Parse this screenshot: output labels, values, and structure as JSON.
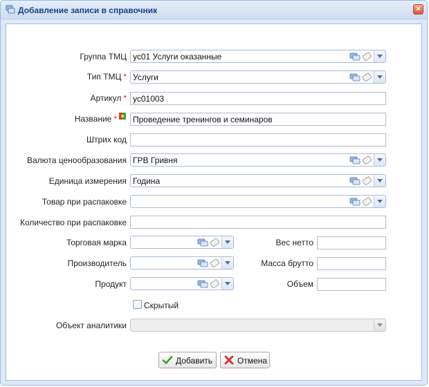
{
  "window": {
    "title": "Добавление записи в справочник",
    "close_glyph": "×"
  },
  "form": {
    "group": {
      "label": "Группа ТМЦ",
      "value": "ус01 Услуги оказанные"
    },
    "type": {
      "label": "Тип ТМЦ",
      "required": "*",
      "value": "Услуги"
    },
    "article": {
      "label": "Артикул",
      "required": "*",
      "value": "ус01003"
    },
    "name": {
      "label": "Название",
      "required": "*",
      "value": "Проведение тренингов и семинаров"
    },
    "barcode": {
      "label": "Штрих код",
      "value": ""
    },
    "currency": {
      "label": "Валюта ценообразования",
      "value": "ГРВ Гривня"
    },
    "unit": {
      "label": "Единица измерения",
      "value": "Година"
    },
    "unpack_item": {
      "label": "Товар при распаковке",
      "value": ""
    },
    "unpack_qty": {
      "label": "Количество при распаковке",
      "value": ""
    },
    "brand": {
      "label": "Торговая марка",
      "value": ""
    },
    "manufacturer": {
      "label": "Производитель",
      "value": ""
    },
    "product": {
      "label": "Продукт",
      "value": ""
    },
    "net_weight": {
      "label": "Вес нетто",
      "value": ""
    },
    "gross_weight": {
      "label": "Масса брутто",
      "value": ""
    },
    "volume": {
      "label": "Объем",
      "value": ""
    },
    "hidden": {
      "label": "Скрытый",
      "checked": false
    },
    "analytics": {
      "label": "Объект аналитики",
      "value": ""
    }
  },
  "buttons": {
    "add": "Добавить",
    "cancel": "Отмена"
  },
  "colors": {
    "accent": "#15428b",
    "border": "#99bbe8",
    "required": "#e02020"
  },
  "icons": [
    "window-app-icon",
    "close-icon",
    "lookup-icon",
    "clear-icon",
    "dropdown-arrow-icon",
    "translate-flag-icon",
    "check-icon",
    "cancel-x-icon"
  ]
}
